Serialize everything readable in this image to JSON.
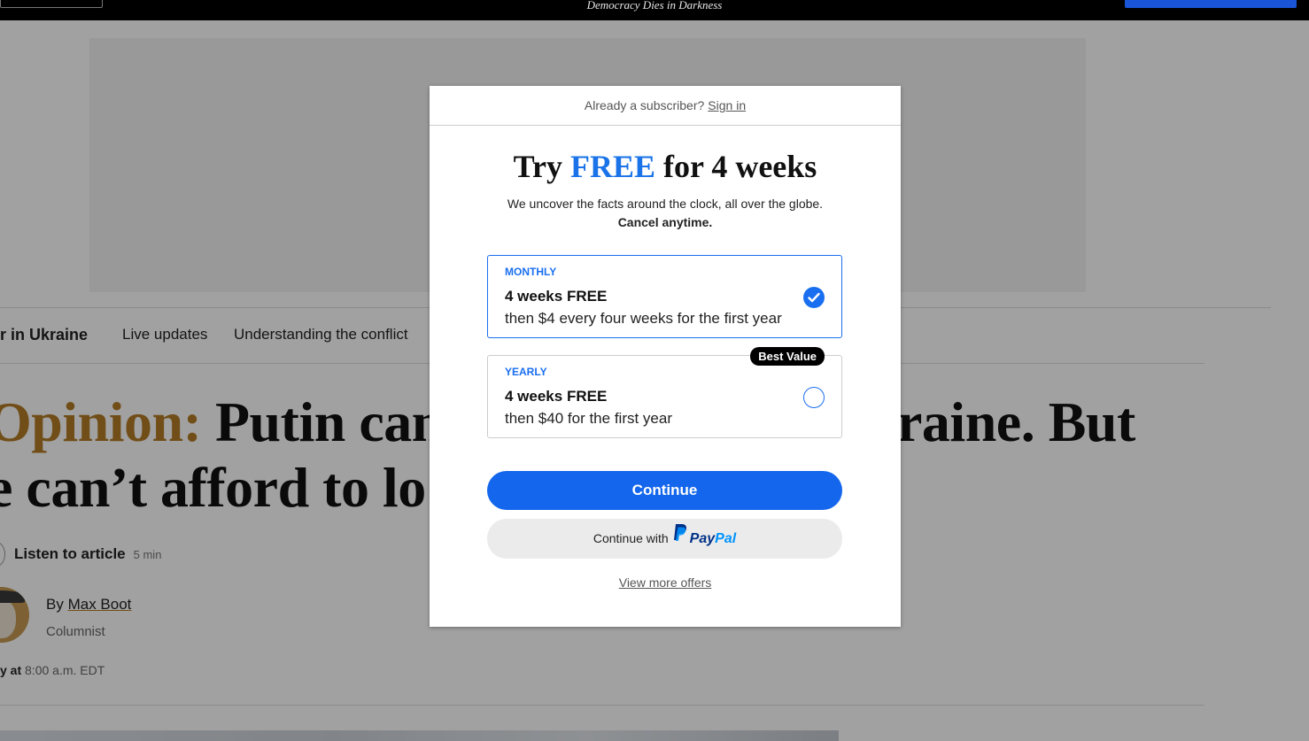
{
  "topbar": {
    "tagline": "Democracy Dies in Darkness"
  },
  "subnav": {
    "section": "r in Ukraine",
    "items": [
      "Live updates",
      "Understanding the conflict"
    ]
  },
  "article": {
    "label": "Opinion:",
    "headline_line1": "Putin can’",
    "headline_line1_right": "raine. But",
    "headline_line2": "e can’t afford to lo",
    "listen_label": "Listen to article",
    "listen_duration": "5 min",
    "byline_prefix": "By",
    "author": "Max Boot",
    "author_role": "Columnist",
    "date_prefix": "y at",
    "date_time": "8:00 a.m. EDT"
  },
  "modal": {
    "already_text": "Already a subscriber?",
    "sign_in": "Sign in",
    "title_try": "Try",
    "title_free": "FREE",
    "title_rest": "for 4 weeks",
    "description": "We uncover the facts around the clock, all over the globe.",
    "cancel_text": "Cancel anytime.",
    "plans": [
      {
        "tag": "MONTHLY",
        "title": "4 weeks FREE",
        "desc": "then $4 every four weeks for the first year",
        "selected": true
      },
      {
        "tag": "YEARLY",
        "title": "4 weeks FREE",
        "desc": "then $40 for the first year",
        "badge": "Best Value",
        "selected": false
      }
    ],
    "continue_label": "Continue",
    "paypal_prefix": "Continue with",
    "paypal_word_1": "Pay",
    "paypal_word_2": "Pal",
    "more_offers": "View more offers"
  },
  "colors": {
    "accent_blue": "#1467ed",
    "opinion_gold": "#b37c27"
  }
}
